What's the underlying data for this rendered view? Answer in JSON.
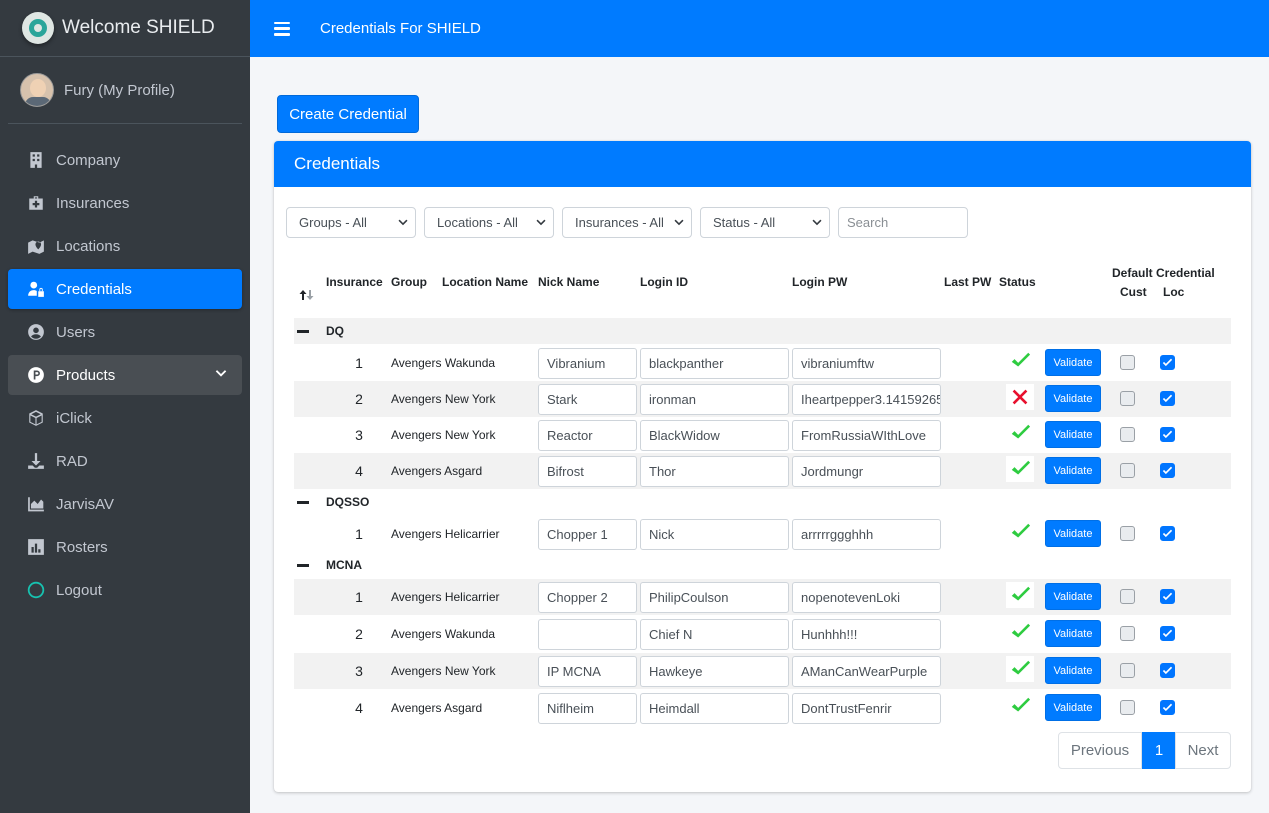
{
  "brand": {
    "title": "Welcome SHIELD"
  },
  "user": {
    "name": "Fury (My Profile)"
  },
  "sidebar": {
    "items": [
      {
        "label": "Company",
        "icon": "building-icon"
      },
      {
        "label": "Insurances",
        "icon": "medkit-icon"
      },
      {
        "label": "Locations",
        "icon": "map-marker-icon"
      },
      {
        "label": "Credentials",
        "icon": "user-lock-icon"
      },
      {
        "label": "Users",
        "icon": "user-circle-icon"
      },
      {
        "label": "Products",
        "icon": "product-p-icon"
      },
      {
        "label": "iClick",
        "icon": "cube-icon"
      },
      {
        "label": "RAD",
        "icon": "download-icon"
      },
      {
        "label": "JarvisAV",
        "icon": "area-chart-icon"
      },
      {
        "label": "Rosters",
        "icon": "bar-chart-icon"
      },
      {
        "label": "Logout",
        "icon": "circle-icon"
      }
    ]
  },
  "topbar": {
    "title": "Credentials For SHIELD"
  },
  "actions": {
    "create_label": "Create Credential"
  },
  "card": {
    "title": "Credentials"
  },
  "filters": {
    "groups": "Groups - All",
    "locations": "Locations - All",
    "insurances": "Insurances - All",
    "status": "Status - All",
    "search_placeholder": "Search"
  },
  "table": {
    "headers": {
      "insurance": "Insurance",
      "group": "Group",
      "location": "Location Name",
      "nick": "Nick Name",
      "login": "Login ID",
      "pw": "Login PW",
      "last_pw": "Last PW",
      "status": "Status",
      "default_cust_1": "Default",
      "default_cust_2": "Cust",
      "cred_loc_1": "Credential",
      "cred_loc_2": "Loc"
    },
    "groups": [
      {
        "name": "DQ",
        "rows": [
          {
            "num": "1",
            "location": "Avengers Wakunda",
            "nick": "Vibranium",
            "login": "blackpanther",
            "pw": "vibraniumftw",
            "status": "ok"
          },
          {
            "num": "2",
            "location": "Avengers New York",
            "nick": "Stark",
            "login": "ironman",
            "pw": "Iheartpepper3.14159265",
            "status": "fail"
          },
          {
            "num": "3",
            "location": "Avengers New York",
            "nick": "Reactor",
            "login": "BlackWidow",
            "pw": "FromRussiaWIthLove",
            "status": "ok"
          },
          {
            "num": "4",
            "location": "Avengers Asgard",
            "nick": "Bifrost",
            "login": "Thor",
            "pw": "Jordmungr",
            "status": "ok"
          }
        ]
      },
      {
        "name": "DQSSO",
        "rows": [
          {
            "num": "1",
            "location": "Avengers Helicarrier",
            "nick": "Chopper 1",
            "login": "Nick",
            "pw": "arrrrrggghhh",
            "status": "ok"
          }
        ]
      },
      {
        "name": "MCNA",
        "rows": [
          {
            "num": "1",
            "location": "Avengers Helicarrier",
            "nick": "Chopper 2",
            "login": "PhilipCoulson",
            "pw": "nopenotevenLoki",
            "status": "ok"
          },
          {
            "num": "2",
            "location": "Avengers Wakunda",
            "nick": "",
            "login": "Chief N",
            "pw": "Hunhhh!!!",
            "status": "ok"
          },
          {
            "num": "3",
            "location": "Avengers New York",
            "nick": "IP MCNA",
            "login": "Hawkeye",
            "pw": "AManCanWearPurple",
            "status": "ok"
          },
          {
            "num": "4",
            "location": "Avengers Asgard",
            "nick": "Niflheim",
            "login": "Heimdall",
            "pw": "DontTrustFenrir",
            "status": "ok"
          }
        ]
      }
    ],
    "validate_label": "Validate"
  },
  "pagination": {
    "prev": "Previous",
    "current": "1",
    "next": "Next"
  },
  "colors": {
    "primary": "#007bff",
    "sidebar": "#343a40",
    "ok": "#2ecc40",
    "fail": "#e8102e"
  }
}
